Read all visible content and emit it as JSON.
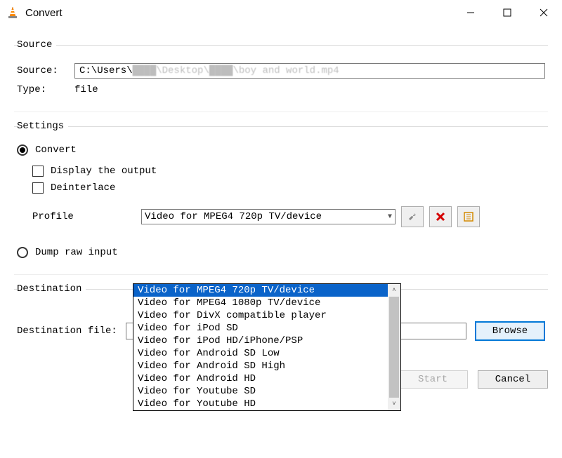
{
  "window": {
    "title": "Convert"
  },
  "source": {
    "legend": "Source",
    "source_label": "Source:",
    "source_value": "C:\\Users\\████\\Desktop\\████\\boy and world.mp4",
    "type_label": "Type:",
    "type_value": "file"
  },
  "settings": {
    "legend": "Settings",
    "convert_label": "Convert",
    "display_output_label": "Display the output",
    "deinterlace_label": "Deinterlace",
    "profile_label": "Profile",
    "profile_selected": "Video for MPEG4 720p TV/device",
    "profile_options": [
      "Video for MPEG4 720p TV/device",
      "Video for MPEG4 1080p TV/device",
      "Video for DivX compatible player",
      "Video for iPod SD",
      "Video for iPod HD/iPhone/PSP",
      "Video for Android SD Low",
      "Video for Android SD High",
      "Video for Android HD",
      "Video for Youtube SD",
      "Video for Youtube HD"
    ],
    "dump_raw_label": "Dump raw input"
  },
  "destination": {
    "legend": "Destination",
    "file_label": "Destination file:",
    "file_value": "",
    "browse_label": "Browse"
  },
  "footer": {
    "start_label": "Start",
    "cancel_label": "Cancel"
  }
}
